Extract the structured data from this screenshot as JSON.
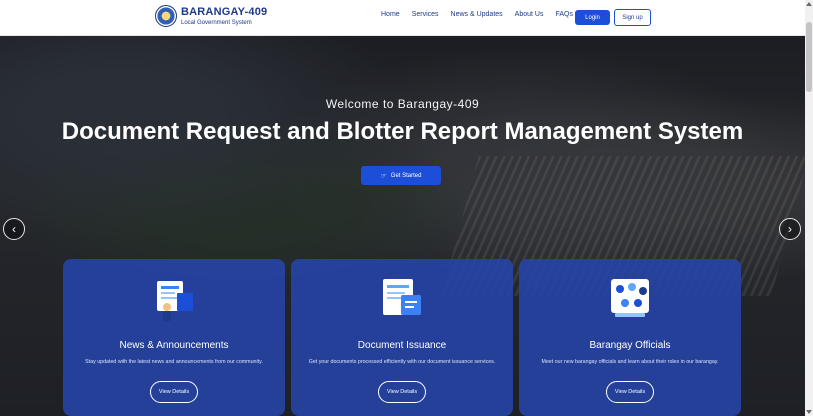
{
  "brand": {
    "title": "BARANGAY-409",
    "subtitle": "Local Government System"
  },
  "nav": {
    "home": "Home",
    "services": "Services",
    "news": "News & Updates",
    "about": "About Us",
    "faqs": "FAQs"
  },
  "auth": {
    "login": "Login",
    "signup": "Sign up"
  },
  "hero": {
    "welcome": "Welcome to Barangay-409",
    "headline": "Document Request and Blotter Report Management System",
    "cta": "Get Started"
  },
  "cards": [
    {
      "title": "News & Announcements",
      "desc": "Stay updated with the latest news and announcements from our community.",
      "button": "View Details"
    },
    {
      "title": "Document Issuance",
      "desc": "Get your documents processed efficiently with our document issuance services.",
      "button": "View Details"
    },
    {
      "title": "Barangay Officials",
      "desc": "Meet our new barangay officials and learn about their roles in our barangay.",
      "button": "View Details"
    }
  ],
  "colors": {
    "primary": "#1d4ed8",
    "brand": "#1e3a8a",
    "card": "#2544aa"
  }
}
